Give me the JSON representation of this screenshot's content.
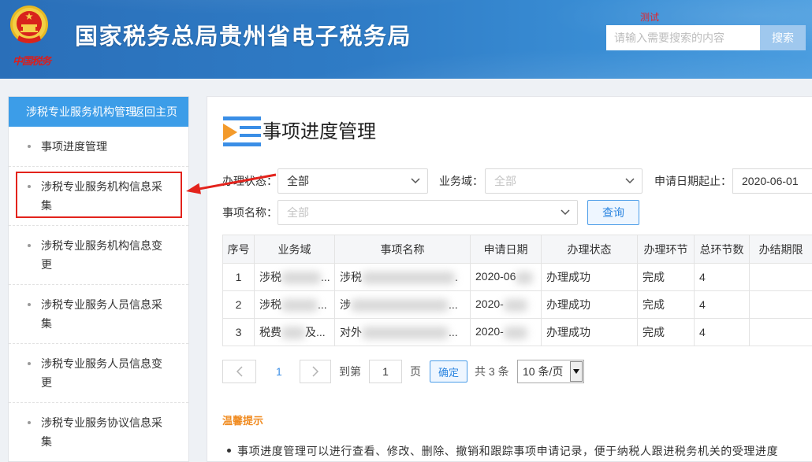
{
  "header": {
    "logo_text": "中国税务",
    "title": "国家税务总局贵州省电子税务局",
    "env_tag": "测试",
    "search": {
      "placeholder": "请输入需要搜索的内容",
      "button_label": "搜索"
    }
  },
  "sidebar": {
    "module_title": "涉税专业服务机构管理",
    "back_link": "返回主页",
    "items": [
      {
        "label": "事项进度管理"
      },
      {
        "label": "涉税专业服务机构信息采集"
      },
      {
        "label": "涉税专业服务机构信息变更"
      },
      {
        "label": "涉税专业服务人员信息采集"
      },
      {
        "label": "涉税专业服务人员信息变更"
      },
      {
        "label": "涉税专业服务协议信息采集"
      }
    ]
  },
  "main": {
    "title": "事项进度管理",
    "filters": {
      "status": {
        "label": "办理状态：",
        "value": "全部"
      },
      "domain": {
        "label": "业务域：",
        "placeholder": "全部"
      },
      "date_range": {
        "label": "申请日期起止：",
        "start": "2020-06-01"
      },
      "item_name": {
        "label": "事项名称：",
        "placeholder": "全部"
      },
      "query_button": "查询"
    },
    "table": {
      "columns": [
        "序号",
        "业务域",
        "事项名称",
        "申请日期",
        "办理状态",
        "办理环节",
        "总环节数",
        "办结期限"
      ],
      "rows": [
        {
          "index": "1",
          "domain": {
            "start": "涉税",
            "end": "..."
          },
          "name": {
            "start": "涉税",
            "end": "."
          },
          "date": {
            "start": "2020-06"
          },
          "status": "办理成功",
          "step": "完成",
          "total_steps": "4",
          "deadline": ""
        },
        {
          "index": "2",
          "domain": {
            "start": "涉税",
            "end": "..."
          },
          "name": {
            "start": "涉",
            "end": "..."
          },
          "date": {
            "start": "2020-"
          },
          "status": "办理成功",
          "step": "完成",
          "total_steps": "4",
          "deadline": ""
        },
        {
          "index": "3",
          "domain": {
            "start": "税费",
            "end": "及..."
          },
          "name": {
            "start": "对外",
            "end": "..."
          },
          "date": {
            "start": "2020-"
          },
          "status": "办理成功",
          "step": "完成",
          "total_steps": "4",
          "deadline": ""
        }
      ]
    },
    "pagination": {
      "current_page": "1",
      "goto_label": "到第",
      "goto_value": "1",
      "page_suffix": "页",
      "confirm_label": "确定",
      "total": "共 3 条",
      "page_size": "10 条/页"
    },
    "tips": {
      "title": "温馨提示",
      "items": [
        "事项进度管理可以进行查看、修改、删除、撤销和跟踪事项申请记录，便于纳税人跟进税务机关的受理进度"
      ]
    }
  },
  "colors": {
    "header_blue": "#2f7cc6",
    "sidebar_head_blue": "#3c9de8",
    "accent_blue": "#3a8ee6",
    "tip_orange": "#f08c22",
    "annotation_red": "#e3231c"
  },
  "icons": {
    "logo": "national-emblem-icon",
    "title": "list-play-icon",
    "select": "chevron-down-icon",
    "prev": "chevron-left-icon",
    "next": "chevron-right-icon",
    "page_size": "triangle-down-icon"
  }
}
